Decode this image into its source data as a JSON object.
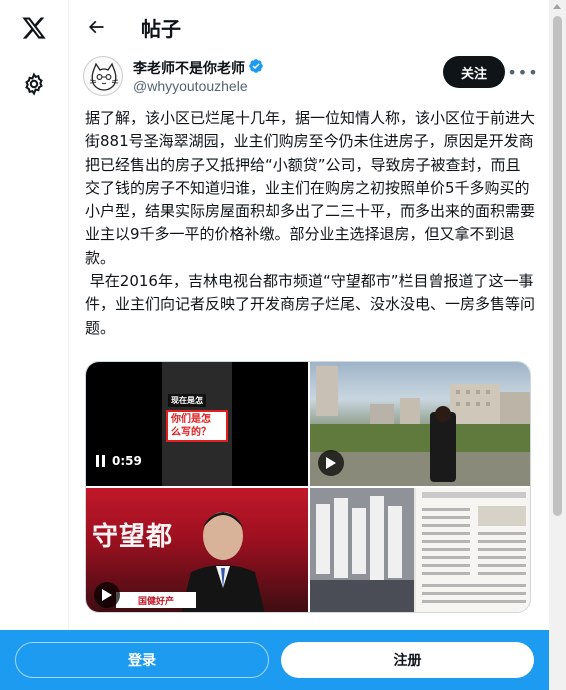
{
  "header": {
    "title": "帖子"
  },
  "author": {
    "name": "李老师不是你老师",
    "handle": "@whyyoutouzhele",
    "verified": true,
    "follow_label": "关注",
    "more_label": "•••"
  },
  "post": {
    "text": "据了解，该小区已烂尾十几年，据一位知情人称，该小区位于前进大街881号圣海翠湖园，业主们购房至今仍未住进房子，原因是开发商把已经售出的房子又抵押给“小额贷”公司，导致房子被查封，而且交了钱的房子不知道归谁，业主们在购房之初按照单价5千多购买的小户型，结果实际房屋面积却多出了二三十平，而多出来的面积需要业主以9千多一平的价格补缴。部分业主选择退房，但又拿不到退款。\n 早在2016年，吉林电视台都市频道“守望都市”栏目曾报道了这一事件，业主们向记者反映了开发商房子烂尾、没水没电、一房多售等问题。"
  },
  "media": {
    "video_duration": "0:59",
    "caption_top": "现在是怎",
    "caption_box": "你们是怎\n么写的？",
    "broadcast_title": "守望都",
    "broadcast_ticker": "国健好产"
  },
  "bottom": {
    "login": "登录",
    "signup": "注册"
  },
  "colors": {
    "accent": "#1d9bf0",
    "text": "#0f1419",
    "secondary": "#536471"
  }
}
